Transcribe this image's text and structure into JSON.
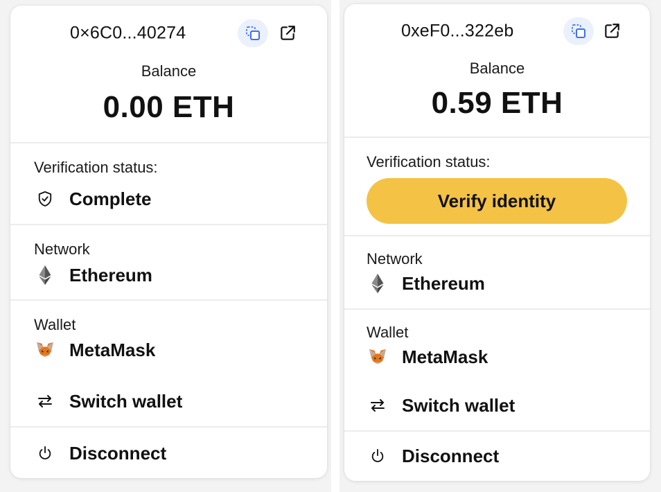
{
  "left": {
    "address": "0×6C0...40274",
    "balance_label": "Balance",
    "balance_value": "0.00 ETH",
    "verification_label": "Verification status:",
    "verification_value": "Complete",
    "network_label": "Network",
    "network_value": "Ethereum",
    "wallet_label": "Wallet",
    "wallet_value": "MetaMask",
    "switch_label": "Switch wallet",
    "disconnect_label": "Disconnect"
  },
  "right": {
    "address": "0xeF0...322eb",
    "balance_label": "Balance",
    "balance_value": "0.59 ETH",
    "verification_label": "Verification status:",
    "verify_button": "Verify identity",
    "network_label": "Network",
    "network_value": "Ethereum",
    "wallet_label": "Wallet",
    "wallet_value": "MetaMask",
    "switch_label": "Switch wallet",
    "disconnect_label": "Disconnect"
  },
  "colors": {
    "verify_button_bg": "#f4c244",
    "copy_button_bg": "#eaf0fc",
    "copy_icon": "#3b6ff5"
  },
  "icons": {
    "copy": "copy-icon",
    "external": "external-link-icon",
    "verified": "shield-check-icon",
    "network": "ethereum-icon",
    "wallet": "metamask-fox-icon",
    "switch": "switch-arrows-icon",
    "disconnect": "power-icon"
  }
}
